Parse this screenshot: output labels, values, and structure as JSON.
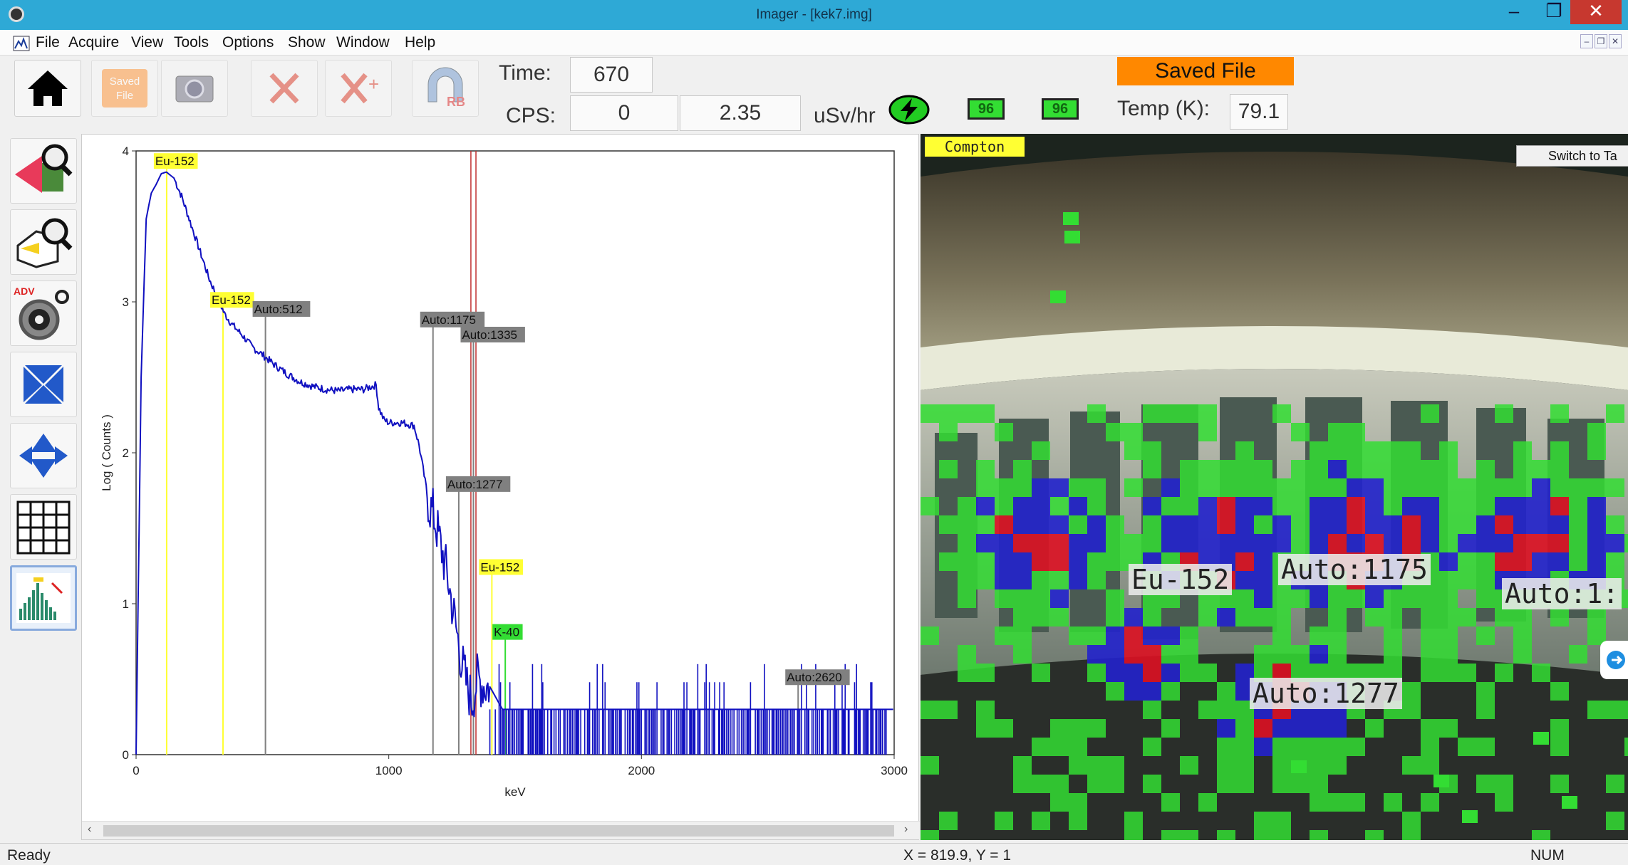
{
  "window": {
    "title": "Imager - [kek7.img]",
    "minimize": "–",
    "maximize": "❐",
    "close": "✕"
  },
  "menu": [
    "File",
    "Acquire",
    "View",
    "Tools",
    "Options",
    "Show",
    "Window",
    "Help"
  ],
  "toolbar": {
    "saved_file_btn": "Saved File",
    "rb_label": "RB",
    "time_label": "Time:",
    "time_value": "670",
    "cps_label": "CPS:",
    "cps_value": "0",
    "dose_value": "2.35",
    "dose_unit": "uSv/hr",
    "battery1": "96",
    "battery2": "96",
    "temp_label": "Temp (K):",
    "temp_value": "79.1",
    "saved_file_badge": "Saved File"
  },
  "sidetools": {
    "adv_label": "ADV"
  },
  "chart_data": {
    "type": "line",
    "xlabel": "keV",
    "ylabel": "Log ( Counts )",
    "xlim": [
      0,
      3000
    ],
    "ylim": [
      0,
      4
    ],
    "x_ticks": [
      0,
      1000,
      2000,
      3000
    ],
    "y_ticks": [
      0,
      1,
      2,
      3,
      4
    ],
    "series_color": "#1010c0",
    "spectrum": {
      "x": [
        0,
        20,
        40,
        60,
        80,
        100,
        120,
        150,
        180,
        210,
        250,
        290,
        330,
        350,
        380,
        420,
        460,
        500,
        550,
        600,
        650,
        700,
        750,
        800,
        850,
        900,
        950,
        960,
        980,
        1000,
        1050,
        1100,
        1120,
        1140,
        1160,
        1175,
        1190,
        1210,
        1230,
        1250,
        1270,
        1290,
        1310,
        1330,
        1350,
        1380,
        1400,
        1450,
        1500,
        3000
      ],
      "y": [
        0,
        2.5,
        3.55,
        3.72,
        3.78,
        3.85,
        3.86,
        3.82,
        3.7,
        3.55,
        3.35,
        3.15,
        3.0,
        2.92,
        2.85,
        2.78,
        2.7,
        2.65,
        2.58,
        2.52,
        2.47,
        2.44,
        2.42,
        2.41,
        2.42,
        2.42,
        2.45,
        2.3,
        2.22,
        2.2,
        2.2,
        2.18,
        2.05,
        1.85,
        1.65,
        1.6,
        1.5,
        1.35,
        1.2,
        1.0,
        0.8,
        0.6,
        0.45,
        0.35,
        0.5,
        0.45,
        0.45,
        0.3,
        0.3,
        0.3
      ]
    },
    "markers": [
      {
        "label": "Eu-152",
        "x": 121,
        "color": "#ffff33",
        "label_y": 3.9
      },
      {
        "label": "Eu-152",
        "x": 344,
        "color": "#ffff33",
        "label_y": 2.98
      },
      {
        "label": "Auto:512",
        "x": 512,
        "color": "#808080",
        "label_y": 2.92
      },
      {
        "label": "Auto:1175",
        "x": 1175,
        "color": "#808080",
        "label_y": 2.85
      },
      {
        "label": "Auto:1335",
        "x": 1335,
        "color": "#808080",
        "label_y": 2.75
      },
      {
        "label": "Auto:1277",
        "x": 1277,
        "color": "#808080",
        "label_y": 1.76
      },
      {
        "label": "Eu-152",
        "x": 1408,
        "color": "#ffff33",
        "label_y": 1.21
      },
      {
        "label": "K-40",
        "x": 1461,
        "color": "#33dd33",
        "label_y": 0.78
      },
      {
        "label": "Auto:2620",
        "x": 2620,
        "color": "#808080",
        "label_y": 0.48
      }
    ],
    "red_lines": [
      1325,
      1345
    ]
  },
  "camera": {
    "mode_badge": "Compton",
    "switch_btn": "Switch to Ta",
    "overlay_labels": [
      "Eu-152",
      "Auto:1175",
      "Auto:1277",
      "Auto:1:"
    ],
    "colors": {
      "green": "#33dd33",
      "blue": "#2222cc",
      "red": "#dd1122"
    }
  },
  "status": {
    "left": "Ready",
    "coords": "X = 819.9, Y = 1",
    "num": "NUM"
  }
}
